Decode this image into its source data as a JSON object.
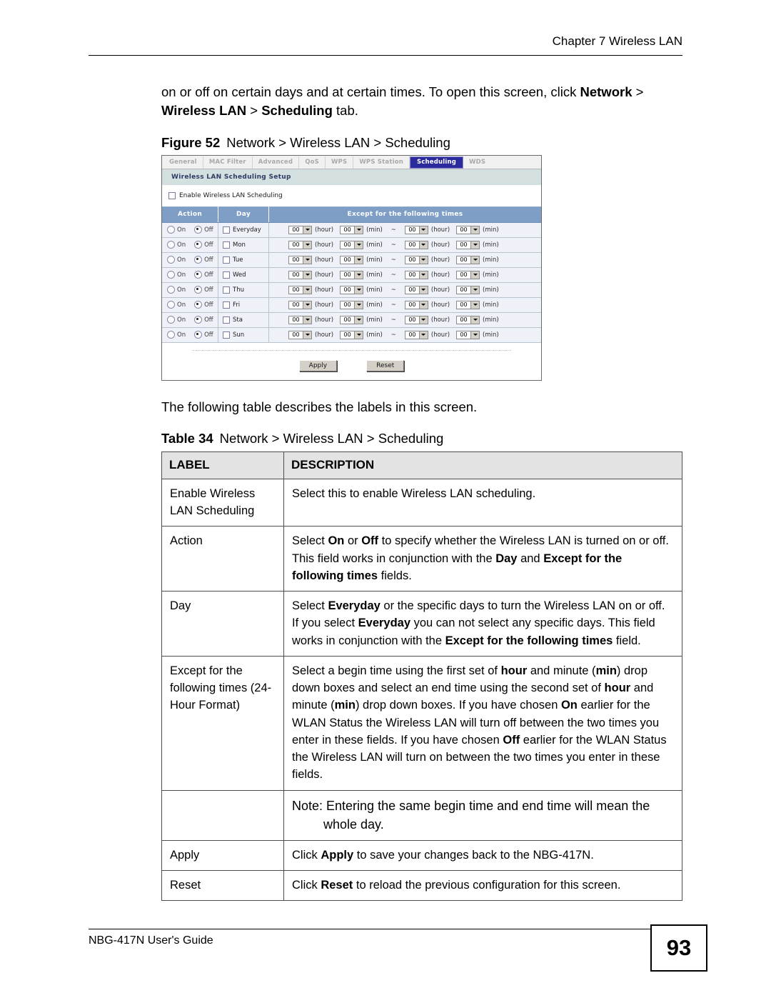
{
  "header": {
    "chapter": "Chapter 7 Wireless LAN"
  },
  "intro": {
    "prefix": "on or off on certain days and at certain times. To open this screen, click ",
    "b1": "Network",
    "mid1": " > ",
    "b2": "Wireless LAN",
    "mid2": " > ",
    "b3": "Scheduling",
    "suffix": " tab."
  },
  "figure": {
    "label": "Figure 52",
    "title": "Network > Wireless LAN > Scheduling"
  },
  "screenshot": {
    "tabs": [
      {
        "label": "General",
        "active": false
      },
      {
        "label": "MAC Filter",
        "active": false
      },
      {
        "label": "Advanced",
        "active": false
      },
      {
        "label": "QoS",
        "active": false
      },
      {
        "label": "WPS",
        "active": false
      },
      {
        "label": "WPS Station",
        "active": false
      },
      {
        "label": "Scheduling",
        "active": true
      },
      {
        "label": "WDS",
        "active": false
      }
    ],
    "section_title": "Wireless LAN Scheduling Setup",
    "enable_checkbox_label": "Enable Wireless LAN Scheduling",
    "enable_checked": false,
    "columns": [
      "Action",
      "Day",
      "Except for the following times"
    ],
    "radio_on_label": "On",
    "radio_off_label": "Off",
    "hour_unit": "(hour)",
    "min_unit": "(min)",
    "range_separator": "~",
    "default_time_value": "00",
    "rows": [
      {
        "day": "Everyday",
        "action": "Off",
        "checked": false,
        "begin_hour": "00",
        "begin_min": "00",
        "end_hour": "00",
        "end_min": "00"
      },
      {
        "day": "Mon",
        "action": "Off",
        "checked": false,
        "begin_hour": "00",
        "begin_min": "00",
        "end_hour": "00",
        "end_min": "00"
      },
      {
        "day": "Tue",
        "action": "Off",
        "checked": false,
        "begin_hour": "00",
        "begin_min": "00",
        "end_hour": "00",
        "end_min": "00"
      },
      {
        "day": "Wed",
        "action": "Off",
        "checked": false,
        "begin_hour": "00",
        "begin_min": "00",
        "end_hour": "00",
        "end_min": "00"
      },
      {
        "day": "Thu",
        "action": "Off",
        "checked": false,
        "begin_hour": "00",
        "begin_min": "00",
        "end_hour": "00",
        "end_min": "00"
      },
      {
        "day": "Fri",
        "action": "Off",
        "checked": false,
        "begin_hour": "00",
        "begin_min": "00",
        "end_hour": "00",
        "end_min": "00"
      },
      {
        "day": "Sta",
        "action": "Off",
        "checked": false,
        "begin_hour": "00",
        "begin_min": "00",
        "end_hour": "00",
        "end_min": "00"
      },
      {
        "day": "Sun",
        "action": "Off",
        "checked": false,
        "begin_hour": "00",
        "begin_min": "00",
        "end_hour": "00",
        "end_min": "00"
      }
    ],
    "apply_label": "Apply",
    "reset_label": "Reset",
    "colors": {
      "active_tab_bg": "#2a2a9c",
      "table_header_bg": "#7e9ec6",
      "section_bar_bg": "#d4dfe0",
      "row_bg": "#eef2f8"
    }
  },
  "lead_in": "The following table describes the labels in this screen.",
  "table": {
    "label": "Table 34",
    "title": "Network > Wireless LAN > Scheduling",
    "columns": [
      "LABEL",
      "DESCRIPTION"
    ],
    "rows": [
      {
        "label": "Enable Wireless LAN Scheduling",
        "description_plain": "Select this to enable Wireless LAN scheduling."
      },
      {
        "label": "Action",
        "description_plain": "Select On or Off to specify whether the Wireless LAN is turned on or off. This field works in conjunction with the Day and Except for the following times fields."
      },
      {
        "label": "Day",
        "description_plain": "Select Everyday or the specific days to turn the Wireless LAN on or off. If you select Everyday you can not select any specific days. This field works in conjunction with the  Except for the following times field."
      },
      {
        "label": "Except for the following times (24-Hour Format)",
        "description_plain": "Select a begin time using the first set of hour and minute (min) drop down boxes and select an end time using the second set of hour and minute (min) drop down boxes. If you have chosen On earlier for the WLAN Status the Wireless LAN will turn off between the two times you enter in these fields. If you have chosen Off earlier for the WLAN Status the Wireless LAN will turn on between the two times you enter in these fields."
      },
      {
        "label": "",
        "description_plain": "Note: Entering the same begin time and end time will mean the whole day."
      },
      {
        "label": "Apply",
        "description_plain": "Click Apply to save your changes back to the NBG-417N."
      },
      {
        "label": "Reset",
        "description_plain": "Click Reset to reload the previous configuration for this screen."
      }
    ]
  },
  "footer": {
    "guide": "NBG-417N User's Guide",
    "page_number": "93"
  }
}
